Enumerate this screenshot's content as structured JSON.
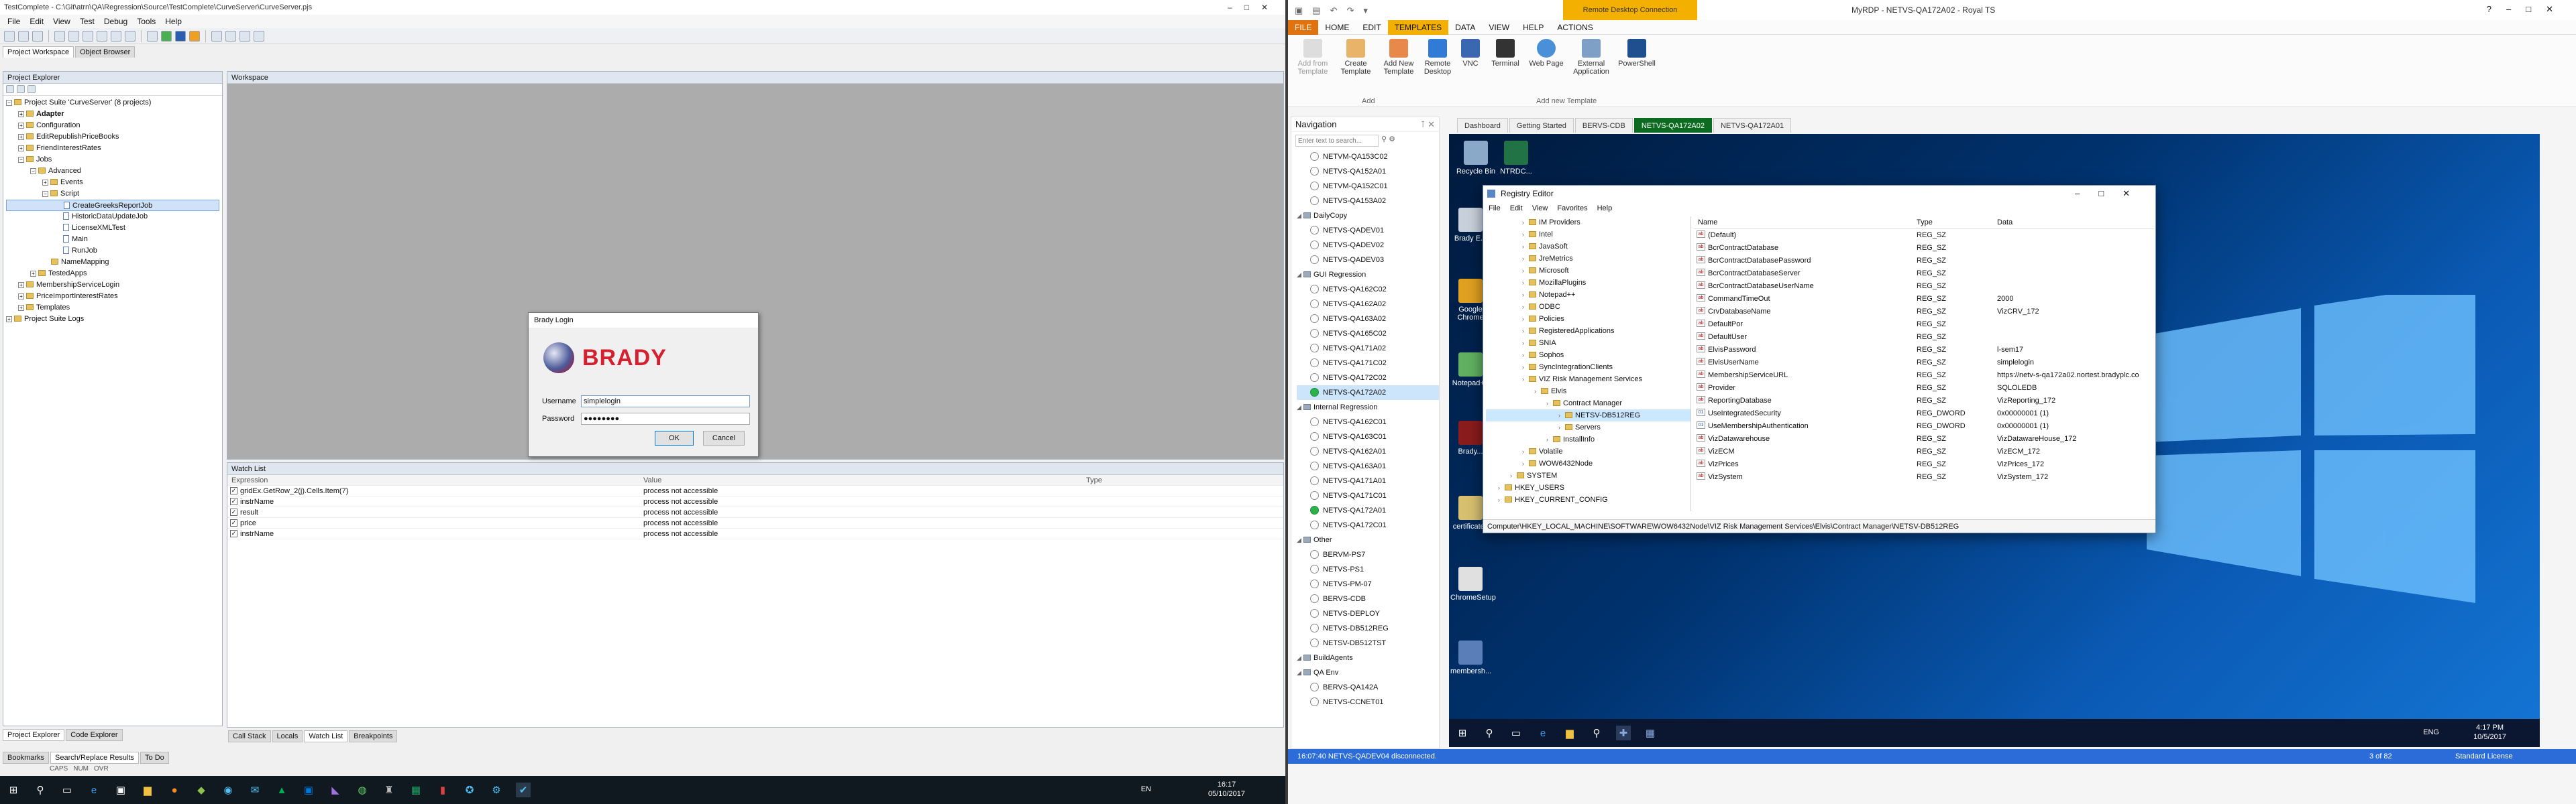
{
  "testcomplete": {
    "title": "TestComplete - C:\\Git\\atrn\\QA\\Regression\\Source\\TestComplete\\CurveServer\\CurveServer.pjs",
    "menu": [
      "File",
      "Edit",
      "View",
      "Test",
      "Debug",
      "Tools",
      "Help"
    ],
    "tabs": [
      "Project Workspace",
      "Object Browser"
    ],
    "project_explorer_title": "Project Explorer",
    "tree": [
      {
        "label": "Project Suite 'CurveServer' (8 projects)",
        "indent": 0,
        "exp": "-",
        "kind": "suite"
      },
      {
        "label": "Adapter",
        "indent": 1,
        "exp": "+",
        "kind": "proj",
        "bold": true
      },
      {
        "label": "Configuration",
        "indent": 1,
        "exp": "+",
        "kind": "proj"
      },
      {
        "label": "EditRepublishPriceBooks",
        "indent": 1,
        "exp": "+",
        "kind": "proj"
      },
      {
        "label": "FriendInterestRates",
        "indent": 1,
        "exp": "+",
        "kind": "proj"
      },
      {
        "label": "Jobs",
        "indent": 1,
        "exp": "-",
        "kind": "proj"
      },
      {
        "label": "Advanced",
        "indent": 2,
        "exp": "-",
        "kind": "folder"
      },
      {
        "label": "Events",
        "indent": 3,
        "exp": "+",
        "kind": "folder"
      },
      {
        "label": "Script",
        "indent": 3,
        "exp": "-",
        "kind": "folder"
      },
      {
        "label": "CreateGreeksReportJob",
        "indent": 4,
        "exp": "",
        "kind": "script",
        "selected": true
      },
      {
        "label": "HistoricDataUpdateJob",
        "indent": 4,
        "exp": "",
        "kind": "script"
      },
      {
        "label": "LicenseXMLTest",
        "indent": 4,
        "exp": "",
        "kind": "script"
      },
      {
        "label": "Main",
        "indent": 4,
        "exp": "",
        "kind": "script"
      },
      {
        "label": "RunJob",
        "indent": 4,
        "exp": "",
        "kind": "script"
      },
      {
        "label": "NameMapping",
        "indent": 3,
        "exp": "",
        "kind": "folder"
      },
      {
        "label": "TestedApps",
        "indent": 2,
        "exp": "+",
        "kind": "folder"
      },
      {
        "label": "MembershipServiceLogin",
        "indent": 1,
        "exp": "+",
        "kind": "proj"
      },
      {
        "label": "PriceImportInterestRates",
        "indent": 1,
        "exp": "+",
        "kind": "proj"
      },
      {
        "label": "Templates",
        "indent": 1,
        "exp": "+",
        "kind": "proj"
      },
      {
        "label": "Project Suite Logs",
        "indent": 0,
        "exp": "+",
        "kind": "folder"
      }
    ],
    "workspace_title": "Workspace",
    "watch_title": "Watch List",
    "watch_headers": [
      "Expression",
      "Value",
      "Type"
    ],
    "watch_rows": [
      {
        "expr": "gridEx.GetRow_2(j).Cells.Item(7)",
        "value": "process not accessible",
        "type": ""
      },
      {
        "expr": "instrName",
        "value": "process not accessible",
        "type": ""
      },
      {
        "expr": "result",
        "value": "process not accessible",
        "type": ""
      },
      {
        "expr": "price",
        "value": "process not accessible",
        "type": ""
      },
      {
        "expr": "instrName",
        "value": "process not accessible",
        "type": ""
      }
    ],
    "bottom_tabs": [
      "Call Stack",
      "Locals",
      "Watch List",
      "Breakpoints"
    ],
    "left_bottom_tabs": [
      "Project Explorer",
      "Code Explorer"
    ],
    "status_tabs": [
      "Bookmarks",
      "Search/Replace Results",
      "To Do"
    ],
    "status_flags": [
      "CAPS",
      "NUM",
      "OVR"
    ],
    "login": {
      "title": "Brady Login",
      "logo": "BRADY",
      "username_label": "Username",
      "username_value": "simplelogin",
      "password_label": "Password",
      "password_value": "●●●●●●●●",
      "ok": "OK",
      "cancel": "Cancel"
    },
    "taskbar": {
      "lang": "EN",
      "time": "16:17",
      "date": "05/10/2017"
    }
  },
  "rdm": {
    "title": "MyRDP - NETVS-QA172A02 - Royal TS",
    "remote_title": "Remote Desktop Connection",
    "ribbon_tabs": [
      "FILE",
      "HOME",
      "EDIT",
      "TEMPLATES",
      "DATA",
      "VIEW",
      "HELP",
      "ACTIONS"
    ],
    "ribbon_buttons": [
      "Add from Template",
      "Create Template",
      "Add New Template",
      "Remote Desktop",
      "VNC",
      "Terminal",
      "Web Page",
      "External Application",
      "PowerShell"
    ],
    "ribbon_groups": [
      "Add",
      "Add new Template"
    ],
    "nav_title": "Navigation",
    "nav_search": "Enter text to search...",
    "nav_items": [
      {
        "label": "NETVM-QA153C02",
        "kind": "conn",
        "indent": 1
      },
      {
        "label": "NETVS-QA152A01",
        "kind": "conn",
        "indent": 1
      },
      {
        "label": "NETVM-QA152C01",
        "kind": "conn",
        "indent": 1
      },
      {
        "label": "NETVS-QA153A02",
        "kind": "conn",
        "indent": 1
      },
      {
        "label": "DailyCopy",
        "kind": "folder",
        "indent": 0
      },
      {
        "label": "NETVS-QADEV01",
        "kind": "conn",
        "indent": 1
      },
      {
        "label": "NETVS-QADEV02",
        "kind": "conn",
        "indent": 1
      },
      {
        "label": "NETVS-QADEV03",
        "kind": "conn",
        "indent": 1
      },
      {
        "label": "GUI Regression",
        "kind": "folder",
        "indent": 0
      },
      {
        "label": "NETVS-QA162C02",
        "kind": "conn",
        "indent": 1
      },
      {
        "label": "NETVS-QA162A02",
        "kind": "conn",
        "indent": 1
      },
      {
        "label": "NETVS-QA163A02",
        "kind": "conn",
        "indent": 1
      },
      {
        "label": "NETVS-QA165C02",
        "kind": "conn",
        "indent": 1
      },
      {
        "label": "NETVS-QA171A02",
        "kind": "conn",
        "indent": 1
      },
      {
        "label": "NETVS-QA171C02",
        "kind": "conn",
        "indent": 1
      },
      {
        "label": "NETVS-QA172C02",
        "kind": "conn",
        "indent": 1
      },
      {
        "label": "NETVS-QA172A02",
        "kind": "ok",
        "indent": 1,
        "selected": true
      },
      {
        "label": "Internal Regression",
        "kind": "folder",
        "indent": 0
      },
      {
        "label": "NETVS-QA162C01",
        "kind": "conn",
        "indent": 1
      },
      {
        "label": "NETVS-QA163C01",
        "kind": "conn",
        "indent": 1
      },
      {
        "label": "NETVS-QA162A01",
        "kind": "conn",
        "indent": 1
      },
      {
        "label": "NETVS-QA163A01",
        "kind": "conn",
        "indent": 1
      },
      {
        "label": "NETVS-QA171A01",
        "kind": "conn",
        "indent": 1
      },
      {
        "label": "NETVS-QA171C01",
        "kind": "conn",
        "indent": 1
      },
      {
        "label": "NETVS-QA172A01",
        "kind": "ok",
        "indent": 1
      },
      {
        "label": "NETVS-QA172C01",
        "kind": "conn",
        "indent": 1
      },
      {
        "label": "Other",
        "kind": "folder",
        "indent": 0
      },
      {
        "label": "BERVM-PS7",
        "kind": "conn",
        "indent": 1
      },
      {
        "label": "NETVS-PS1",
        "kind": "conn",
        "indent": 1
      },
      {
        "label": "NETVS-PM-07",
        "kind": "conn",
        "indent": 1
      },
      {
        "label": "BERVS-CDB",
        "kind": "conn",
        "indent": 1
      },
      {
        "label": "NETVS-DEPLOY",
        "kind": "conn",
        "indent": 1
      },
      {
        "label": "NETVS-DB512REG",
        "kind": "conn",
        "indent": 1
      },
      {
        "label": "NETSV-DB512TST",
        "kind": "conn",
        "indent": 1
      },
      {
        "label": "BuildAgents",
        "kind": "folder",
        "indent": 0
      },
      {
        "label": "QA Env",
        "kind": "folder",
        "indent": 0
      },
      {
        "label": "BERVS-QA142A",
        "kind": "conn",
        "indent": 1
      },
      {
        "label": "NETVS-CCNET01",
        "kind": "conn",
        "indent": 1
      }
    ],
    "doc_tabs": [
      {
        "label": "Dashboard",
        "active": false
      },
      {
        "label": "Getting Started",
        "active": false
      },
      {
        "label": "BERVS-CDB",
        "active": false
      },
      {
        "label": "NETVS-QA172A02",
        "active": true
      },
      {
        "label": "NETVS-QA172A01",
        "active": false
      }
    ],
    "desktop_icons": [
      {
        "label": "Recycle Bin",
        "color": "#8aa9c9"
      },
      {
        "label": "NTRDC...",
        "color": "#217346"
      },
      {
        "label": "Brady E...",
        "color": "#c8d0dc"
      },
      {
        "label": "Google Chrome",
        "color": "#e0a020"
      },
      {
        "label": "Notepad++",
        "color": "#60b060"
      },
      {
        "label": "Brady...",
        "color": "#8a1c1c"
      },
      {
        "label": "certificates",
        "color": "#d8c070"
      },
      {
        "label": "ChromeSetup",
        "color": "#e0e0e0"
      },
      {
        "label": "membersh...",
        "color": "#5a7fb8"
      }
    ],
    "regedit": {
      "title": "Registry Editor",
      "menu": [
        "File",
        "Edit",
        "View",
        "Favorites",
        "Help"
      ],
      "tree": [
        {
          "label": "IM Providers",
          "indent": 3
        },
        {
          "label": "Intel",
          "indent": 3
        },
        {
          "label": "JavaSoft",
          "indent": 3
        },
        {
          "label": "JreMetrics",
          "indent": 3
        },
        {
          "label": "Microsoft",
          "indent": 3
        },
        {
          "label": "MozillaPlugins",
          "indent": 3
        },
        {
          "label": "Notepad++",
          "indent": 3
        },
        {
          "label": "ODBC",
          "indent": 3
        },
        {
          "label": "Policies",
          "indent": 3
        },
        {
          "label": "RegisteredApplications",
          "indent": 3
        },
        {
          "label": "SNIA",
          "indent": 3
        },
        {
          "label": "Sophos",
          "indent": 3
        },
        {
          "label": "SyncIntegrationClients",
          "indent": 3
        },
        {
          "label": "VIZ Risk Management Services",
          "indent": 3
        },
        {
          "label": "Elvis",
          "indent": 4
        },
        {
          "label": "Contract Manager",
          "indent": 5
        },
        {
          "label": "NETSV-DB512REG",
          "indent": 6,
          "selected": true
        },
        {
          "label": "Servers",
          "indent": 6
        },
        {
          "label": "InstallInfo",
          "indent": 5
        },
        {
          "label": "Volatile",
          "indent": 3
        },
        {
          "label": "WOW6432Node",
          "indent": 3
        },
        {
          "label": "SYSTEM",
          "indent": 2
        },
        {
          "label": "HKEY_USERS",
          "indent": 1
        },
        {
          "label": "HKEY_CURRENT_CONFIG",
          "indent": 1
        }
      ],
      "headers": [
        "Name",
        "Type",
        "Data"
      ],
      "rows": [
        {
          "name": "(Default)",
          "type": "REG_SZ",
          "data": "",
          "kind": "ab"
        },
        {
          "name": "BcrContractDatabase",
          "type": "REG_SZ",
          "data": "",
          "kind": "ab"
        },
        {
          "name": "BcrContractDatabasePassword",
          "type": "REG_SZ",
          "data": "",
          "kind": "ab"
        },
        {
          "name": "BcrContractDatabaseServer",
          "type": "REG_SZ",
          "data": "",
          "kind": "ab"
        },
        {
          "name": "BcrContractDatabaseUserName",
          "type": "REG_SZ",
          "data": "",
          "kind": "ab"
        },
        {
          "name": "CommandTimeOut",
          "type": "REG_SZ",
          "data": "2000",
          "kind": "ab"
        },
        {
          "name": "CrvDatabaseName",
          "type": "REG_SZ",
          "data": "VizCRV_172",
          "kind": "ab"
        },
        {
          "name": "DefaultPor",
          "type": "REG_SZ",
          "data": "",
          "kind": "ab"
        },
        {
          "name": "DefaultUser",
          "type": "REG_SZ",
          "data": "",
          "kind": "ab"
        },
        {
          "name": "ElvisPassword",
          "type": "REG_SZ",
          "data": "l-sem17",
          "kind": "ab"
        },
        {
          "name": "ElvisUserName",
          "type": "REG_SZ",
          "data": "simplelogin",
          "kind": "ab"
        },
        {
          "name": "MembershipServiceURL",
          "type": "REG_SZ",
          "data": "https://netv-s-qa172a02.nortest.bradyplc.co",
          "kind": "ab"
        },
        {
          "name": "Provider",
          "type": "REG_SZ",
          "data": "SQLOLEDB",
          "kind": "ab"
        },
        {
          "name": "ReportingDatabase",
          "type": "REG_SZ",
          "data": "VizReporting_172",
          "kind": "ab"
        },
        {
          "name": "UseIntegratedSecurity",
          "type": "REG_DWORD",
          "data": "0x00000001 (1)",
          "kind": "dw"
        },
        {
          "name": "UseMembershipAuthentication",
          "type": "REG_DWORD",
          "data": "0x00000001 (1)",
          "kind": "dw"
        },
        {
          "name": "VizDatawarehouse",
          "type": "REG_SZ",
          "data": "VizDatawareHouse_172",
          "kind": "ab"
        },
        {
          "name": "VizECM",
          "type": "REG_SZ",
          "data": "VizECM_172",
          "kind": "ab"
        },
        {
          "name": "VizPrices",
          "type": "REG_SZ",
          "data": "VizPrices_172",
          "kind": "ab"
        },
        {
          "name": "VizSystem",
          "type": "REG_SZ",
          "data": "VizSystem_172",
          "kind": "ab"
        }
      ],
      "status": "Computer\\HKEY_LOCAL_MACHINE\\SOFTWARE\\WOW6432Node\\VIZ Risk Management Services\\Elvis\\Contract Manager\\NETSV-DB512REG"
    },
    "remote_taskbar": {
      "lang": "ENG",
      "time": "4:17 PM",
      "date": "10/5/2017"
    },
    "status_msg": "16:07:40 NETVS-QADEV04 disconnected.",
    "page": "3 of 82",
    "license": "Standard License"
  }
}
